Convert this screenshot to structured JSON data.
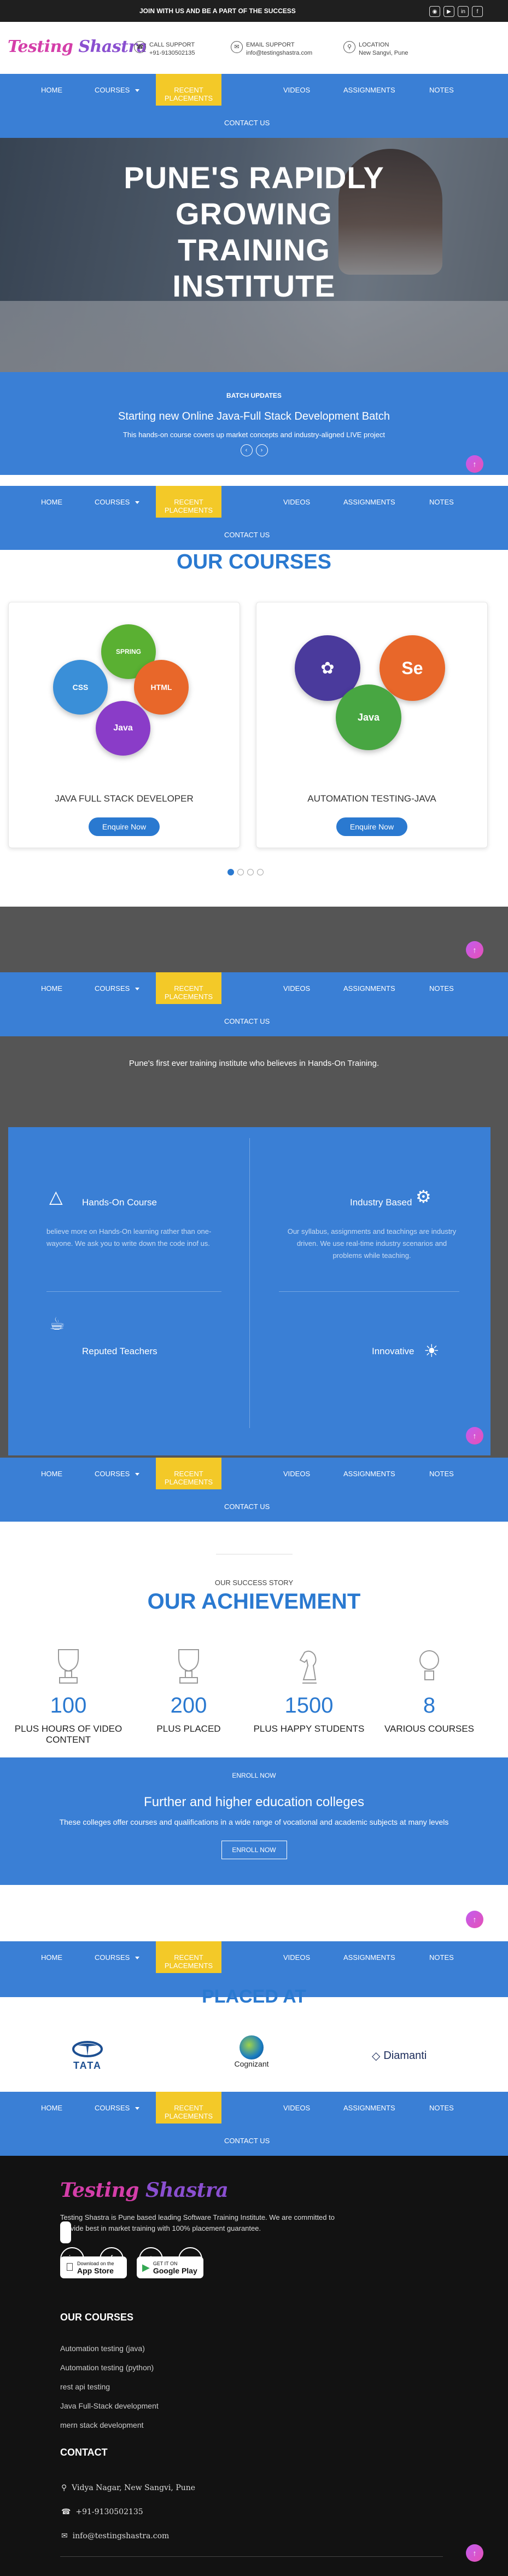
{
  "topbar": {
    "message": "JOIN WITH US AND BE A PART OF THE SUCCESS",
    "socials": [
      "instagram-icon",
      "youtube-icon",
      "linkedin-icon",
      "facebook-icon"
    ]
  },
  "brand": {
    "logo_main": "Testing",
    "logo_sub": "Shastra"
  },
  "contacts": {
    "call": {
      "label": "CALL SUPPORT",
      "value": "+91-9130502135"
    },
    "email": {
      "label": "EMAIL SUPPORT",
      "value": "info@testingshastra.com"
    },
    "location": {
      "label": "LOCATION",
      "value": "New Sangvi, Pune"
    }
  },
  "nav": {
    "home": "HOME",
    "courses": "COURSES",
    "recent": "RECENT PLACEMENTS",
    "videos": "VIDEOS",
    "assignments": "ASSIGNMENTS",
    "notes": "NOTES",
    "contact": "CONTACT US"
  },
  "hero": {
    "line1": "PUNE'S RAPIDLY",
    "line2": "GROWING",
    "line3": "TRAINING",
    "line4": "INSTITUTE"
  },
  "batch": {
    "label": "BATCH UPDATES",
    "headline": "Starting new Online Java-Full Stack Development Batch",
    "desc": "This hands-on course covers up market concepts and industry-aligned LIVE project"
  },
  "courses": {
    "title": "OUR COURSES",
    "cards": [
      {
        "title": "JAVA FULL STACK DEVELOPER",
        "button": "Enquire Now",
        "badges": [
          "SPRING",
          "CSS",
          "HTML",
          "Java"
        ]
      },
      {
        "title": "AUTOMATION TESTING-JAVA",
        "button": "Enquire Now",
        "badges": [
          "Se",
          "Java"
        ]
      }
    ],
    "slide_count": 4,
    "active_slide": 1
  },
  "handson": {
    "tagline": "Pune's first ever training institute who believes in Hands-On Training."
  },
  "features": [
    {
      "title": "Hands-On Course",
      "icon": "flask-icon",
      "desc": "believe more on Hands-On learning rather than one-wayone. We ask you to write down the code inof us."
    },
    {
      "title": "Industry Based",
      "icon": "magnifier-gear-icon",
      "desc": "Our syllabus, assignments and teachings are industry driven. We use real-time industry scenarios and problems while teaching."
    },
    {
      "title": "Reputed Teachers",
      "icon": "trophy-icon",
      "desc": ""
    },
    {
      "title": "Innovative",
      "icon": "bulb-icon",
      "desc": ""
    }
  ],
  "achievement": {
    "kicker": "OUR SUCCESS STORY",
    "title": "OUR ACHIEVEMENT",
    "stats": [
      {
        "value": "100",
        "label": "PLUS HOURS OF VIDEO CONTENT",
        "icon": "trophy-icon"
      },
      {
        "value": "200",
        "label": "PLUS PLACED",
        "icon": "trophy-icon"
      },
      {
        "value": "1500",
        "label": "PLUS HAPPY STUDENTS",
        "icon": "chess-knight-icon"
      },
      {
        "value": "8",
        "label": "VARIOUS COURSES",
        "icon": "bulb-icon"
      }
    ]
  },
  "enroll": {
    "label": "ENROLL NOW",
    "headline": "Further and higher education colleges",
    "desc": "These colleges offer courses and qualifications in a wide range of vocational and academic subjects at many levels",
    "button": "ENROLL NOW"
  },
  "placed": {
    "title": "PLACED AT",
    "companies": [
      "TATA",
      "Cognizant",
      "Diamanti"
    ]
  },
  "footer": {
    "about": "Testing Shastra is Pune based leading Software Training Institute. We are committed to provide best in market training with 100% placement guarantee.",
    "social": [
      "linkedin-icon",
      "facebook-icon",
      "instagram-icon",
      "youtube-icon"
    ],
    "appstore_small": "Download on the",
    "appstore": "App Store",
    "googleplay_small": "GET IT ON",
    "googleplay": "Google Play",
    "courses_title": "OUR COURSES",
    "courses": [
      "Automation testing (java)",
      "Automation testing (python)",
      "rest api testing",
      "Java Full-Stack development",
      "mern stack development"
    ],
    "contact_title": "CONTACT",
    "address": "Vidya Nagar, New Sangvi, Pune",
    "phone": "+91-9130502135",
    "email": "info@testingshastra.com"
  },
  "colors": {
    "blue": "#3a7fd5",
    "yellow": "#f3c928",
    "pink": "#d43ea9",
    "dark": "#121212"
  }
}
